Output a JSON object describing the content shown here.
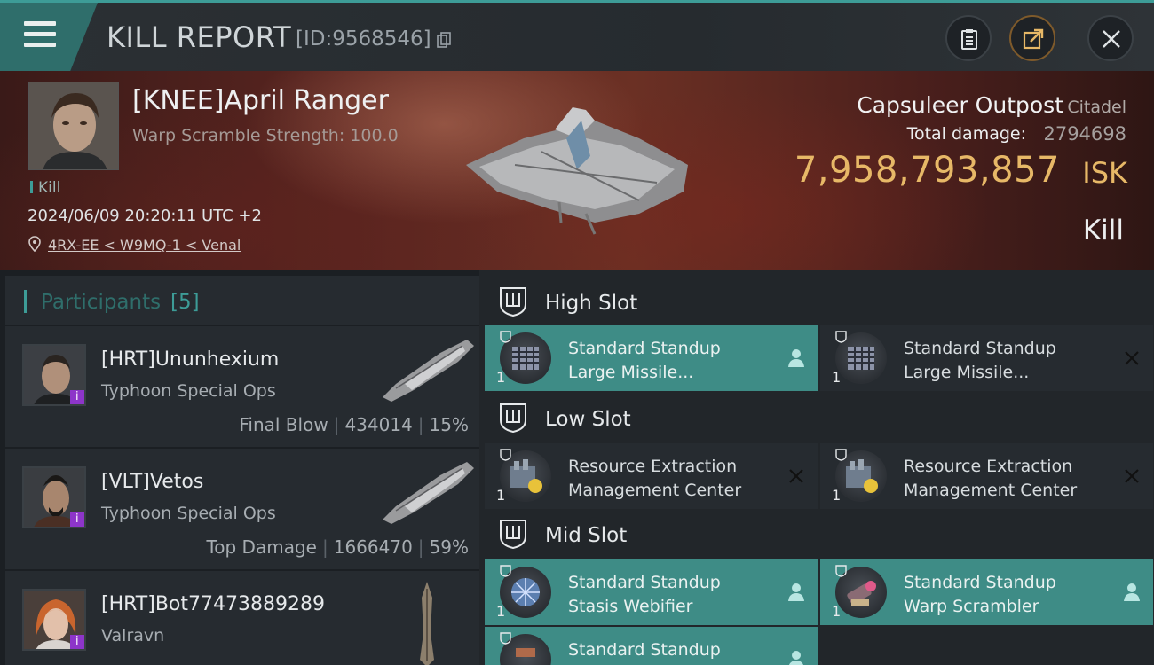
{
  "header": {
    "title": "KILL REPORT",
    "report_id": "[ID:9568546]"
  },
  "victim": {
    "name": "[KNEE]April Ranger",
    "scramble": "Warp Scramble Strength: 100.0",
    "kill_tag": "Kill",
    "timestamp": "2024/06/09 20:20:11 UTC +2",
    "location": "4RX-EE < W9MQ-1 < Venal",
    "ship_name": "Capsuleer Outpost",
    "ship_class": "Citadel",
    "damage_label": "Total damage:",
    "damage_value": "2794698",
    "isk_value": "7,958,793,857",
    "isk_unit": "ISK",
    "result": "Kill"
  },
  "participants": {
    "title": "Participants",
    "count": "[5]",
    "list": [
      {
        "name": "[HRT]Ununhexium",
        "ship": "Typhoon Special Ops",
        "role": "Final Blow",
        "damage": "434014",
        "percent": "15%"
      },
      {
        "name": "[VLT]Vetos",
        "ship": "Typhoon Special Ops",
        "role": "Top Damage",
        "damage": "1666470",
        "percent": "59%"
      },
      {
        "name": "[HRT]Bot77473889289",
        "ship": "Valravn",
        "role": "",
        "damage": "",
        "percent": ""
      }
    ]
  },
  "fitting": {
    "high": {
      "title": "High Slot",
      "modules": [
        {
          "qty": "1",
          "name1": "Standard Standup",
          "name2": "Large Missile...",
          "state": "dropped"
        },
        {
          "qty": "1",
          "name1": "Standard Standup",
          "name2": "Large Missile...",
          "state": "destroyed"
        }
      ]
    },
    "low": {
      "title": "Low Slot",
      "modules": [
        {
          "qty": "1",
          "name1": "Resource Extraction",
          "name2": "Management Center",
          "state": "destroyed"
        },
        {
          "qty": "1",
          "name1": "Resource Extraction",
          "name2": "Management Center",
          "state": "destroyed"
        }
      ]
    },
    "mid": {
      "title": "Mid Slot",
      "modules": [
        {
          "qty": "1",
          "name1": "Standard Standup",
          "name2": "Stasis Webifier",
          "state": "dropped"
        },
        {
          "qty": "1",
          "name1": "Standard Standup",
          "name2": "Warp Scrambler",
          "state": "dropped"
        },
        {
          "qty": "1",
          "name1": "Standard Standup",
          "name2": "",
          "state": "dropped"
        }
      ]
    }
  },
  "icons": {
    "menu": "menu-icon",
    "copy": "copy-icon",
    "clipboard": "clipboard-icon",
    "share": "share-icon",
    "close": "close-icon",
    "location": "location-pin-icon",
    "slot": "shield-slot-icon",
    "dropped": "person-icon",
    "destroyed": "x-icon"
  },
  "colors": {
    "accent": "#3d9c97",
    "isk": "#e7b867",
    "dropped_bg": "#3e8c86",
    "badge": "#8d35c9"
  }
}
